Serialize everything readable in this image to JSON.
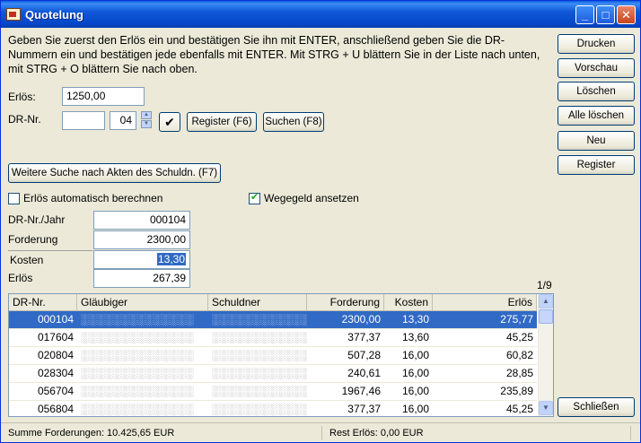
{
  "window": {
    "title": "Quotelung",
    "icon": "app-document-icon"
  },
  "intro": "Geben Sie zuerst den Erlös ein und bestätigen Sie ihn mit ENTER, anschließend geben Sie die DR-Nummern ein und bestätigen jede ebenfalls mit ENTER. Mit STRG + U blättern Sie in der Liste nach unten, mit STRG + O blättern Sie nach oben.",
  "form": {
    "erloes_label": "Erlös:",
    "erloes_value": "1250,00",
    "drnr_label": "DR-Nr.",
    "drnr_value": "",
    "drnr_year": "04",
    "register_btn": "Register (F6)",
    "suchen_btn": "Suchen (F8)",
    "weitere_suche_btn": "Weitere Suche nach Akten des Schuldn. (F7)",
    "auto_erloes_label": "Erlös automatisch berechnen",
    "auto_erloes_checked": false,
    "wegegeld_label": "Wegegeld ansetzen",
    "wegegeld_checked": true
  },
  "detail": {
    "drnr_jahr_label": "DR-Nr./Jahr",
    "drnr_jahr_value": "000104",
    "forderung_label": "Forderung",
    "forderung_value": "2300,00",
    "kosten_label": "Kosten",
    "kosten_value": "13,30",
    "erloes_label": "Erlös",
    "erloes_value": "267,39"
  },
  "page_indicator": "1/9",
  "grid": {
    "columns": [
      "DR-Nr.",
      "Gläubiger",
      "Schuldner",
      "Forderung",
      "Kosten",
      "Erlös"
    ],
    "rows": [
      {
        "drnr": "000104",
        "forderung": "2300,00",
        "kosten": "13,30",
        "erloes": "275,77",
        "selected": true
      },
      {
        "drnr": "017604",
        "forderung": "377,37",
        "kosten": "13,60",
        "erloes": "45,25",
        "selected": false
      },
      {
        "drnr": "020804",
        "forderung": "507,28",
        "kosten": "16,00",
        "erloes": "60,82",
        "selected": false
      },
      {
        "drnr": "028304",
        "forderung": "240,61",
        "kosten": "16,00",
        "erloes": "28,85",
        "selected": false
      },
      {
        "drnr": "056704",
        "forderung": "1967,46",
        "kosten": "16,00",
        "erloes": "235,89",
        "selected": false
      },
      {
        "drnr": "056804",
        "forderung": "377,37",
        "kosten": "16,00",
        "erloes": "45,25",
        "selected": false
      }
    ]
  },
  "sidebar": {
    "buttons": [
      "Drucken",
      "Vorschau",
      "Löschen",
      "Alle löschen",
      "Neu",
      "Register"
    ],
    "close_button": "Schließen"
  },
  "status": {
    "summe": "Summe Forderungen: 10.425,65 EUR",
    "rest": "Rest Erlös: 0,00 EUR"
  },
  "colors": {
    "titlebar": "#0a5ee0",
    "selection": "#316ac5",
    "face": "#ece9d8"
  }
}
